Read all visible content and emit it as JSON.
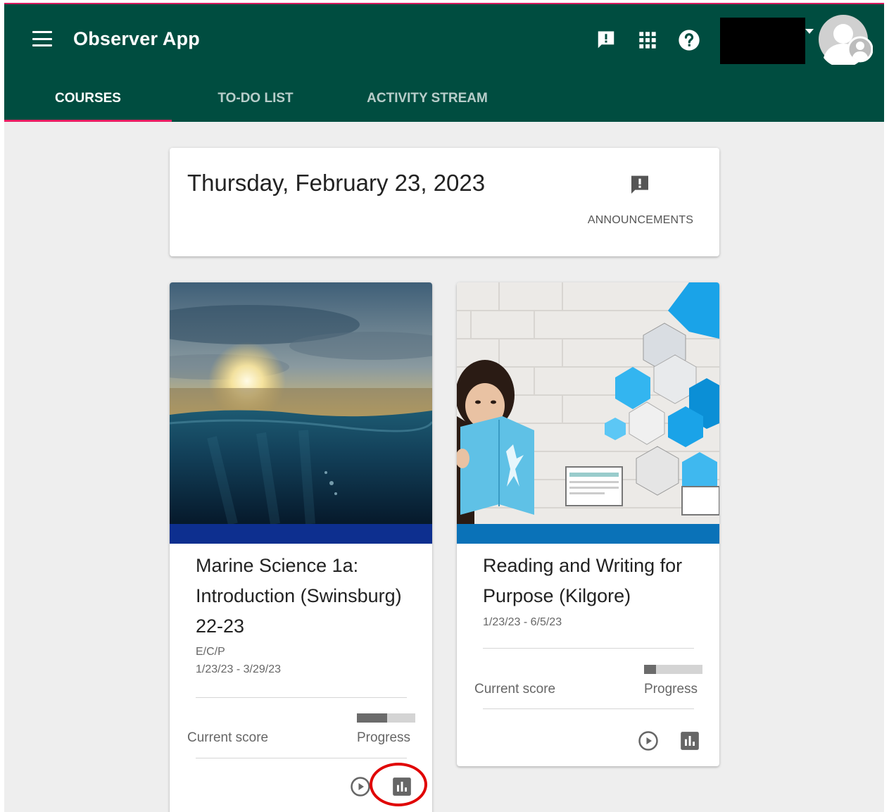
{
  "app": {
    "title": "Observer App",
    "header_color": "#004d40",
    "accent_color": "#e91e63"
  },
  "header_icons": [
    "announcement-icon",
    "apps-grid-icon",
    "help-icon",
    "account-caret-icon",
    "avatar"
  ],
  "tabs": [
    {
      "label": "COURSES",
      "active": true
    },
    {
      "label": "TO-DO LIST",
      "active": false
    },
    {
      "label": "ACTIVITY STREAM",
      "active": false
    }
  ],
  "date_card": {
    "date": "Thursday, February 23, 2023",
    "announcements_label": "ANNOUNCEMENTS"
  },
  "courses": [
    {
      "title": "Marine Science 1a: Introduction (Swinsburg) 22-23",
      "code": "E/C/P",
      "dates": "1/23/23 - 3/29/23",
      "current_score_label": "Current score",
      "progress_label": "Progress",
      "progress_fraction": 0.52,
      "band_color": "#0d2f8f"
    },
    {
      "title": "Reading and Writing for Purpose (Kilgore)",
      "code": "",
      "dates": "1/23/23 - 6/5/23",
      "current_score_label": "Current score",
      "progress_label": "Progress",
      "progress_fraction": 0.2,
      "band_color": "#0a72b8"
    }
  ]
}
